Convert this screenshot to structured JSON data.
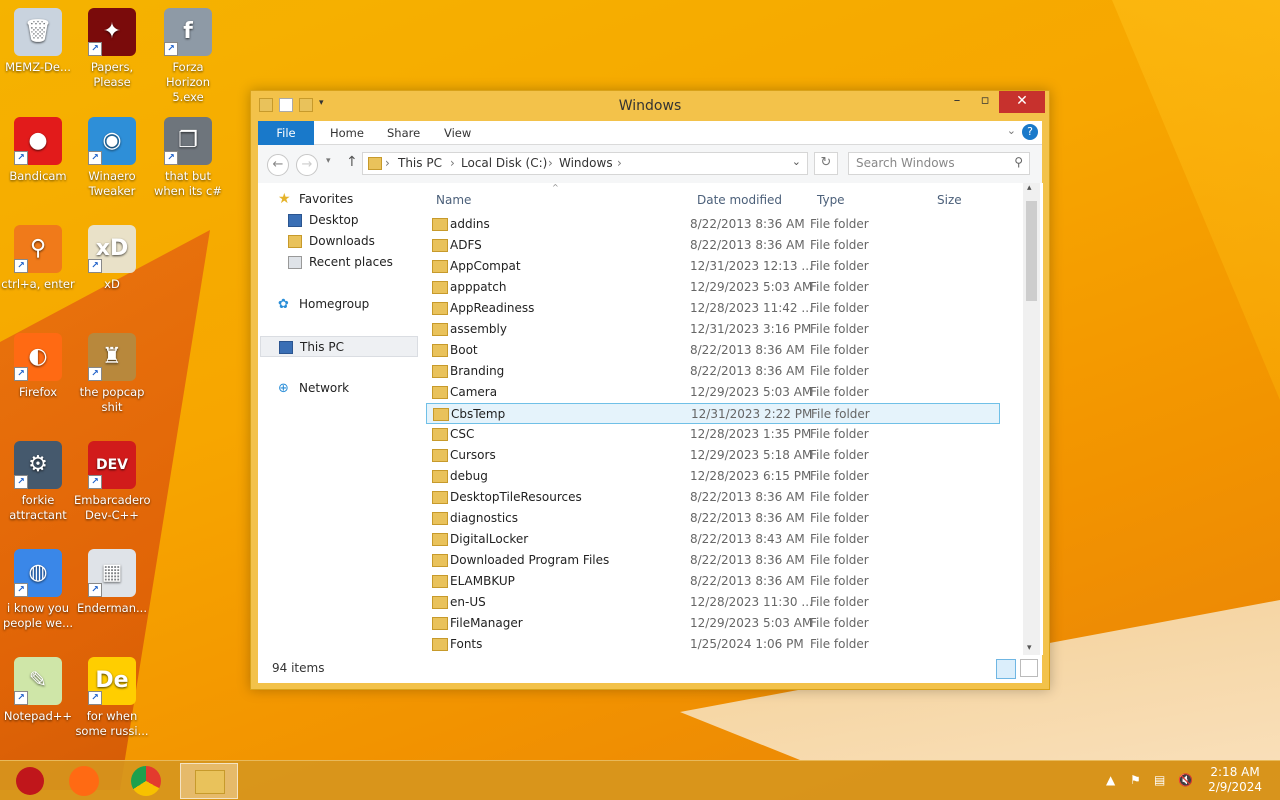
{
  "desktop": {
    "icons": [
      {
        "label": "MEMZ-De...",
        "color": "#c9d3de",
        "glyph": "🗑"
      },
      {
        "label": "Papers, Please",
        "color": "#7a0b0b",
        "glyph": "✦"
      },
      {
        "label": "Forza Horizon 5.exe",
        "color": "#8e9aa6",
        "glyph": "f"
      },
      {
        "label": "Bandicam",
        "color": "#e21b1b",
        "glyph": "●"
      },
      {
        "label": "Winaero Tweaker",
        "color": "#2e8fd8",
        "glyph": "◉"
      },
      {
        "label": "that but when its c#",
        "color": "#6e757c",
        "glyph": "❐"
      },
      {
        "label": "ctrl+a, enter",
        "color": "#f07a1a",
        "glyph": "⚲"
      },
      {
        "label": "xD",
        "color": "#e9e1c8",
        "glyph": "xD"
      },
      {
        "label": "Firefox",
        "color": "#ff6a13",
        "glyph": "◐"
      },
      {
        "label": "the popcap shit",
        "color": "#b8883c",
        "glyph": "♜"
      },
      {
        "label": "forkie attractant",
        "color": "#45596d",
        "glyph": "⚙"
      },
      {
        "label": "Embarcadero Dev-C++",
        "color": "#d11b1b",
        "glyph": "DEV"
      },
      {
        "label": "i know you people we...",
        "color": "#3a87e8",
        "glyph": "◍"
      },
      {
        "label": "Enderman...",
        "color": "#dfe3e8",
        "glyph": "▦"
      },
      {
        "label": "Notepad++",
        "color": "#cfe6a8",
        "glyph": "✎"
      },
      {
        "label": "for when some russi...",
        "color": "#ffce00",
        "glyph": "De"
      }
    ]
  },
  "window": {
    "title": "Windows",
    "tabs": {
      "file": "File",
      "home": "Home",
      "share": "Share",
      "view": "View"
    },
    "address": {
      "crumb1": "This PC",
      "crumb2": "Local Disk (C:)",
      "crumb3": "Windows"
    },
    "search_placeholder": "Search Windows",
    "nav": {
      "favorites": "Favorites",
      "desktop": "Desktop",
      "downloads": "Downloads",
      "recent": "Recent places",
      "homegroup": "Homegroup",
      "thispc": "This PC",
      "network": "Network"
    },
    "columns": {
      "name": "Name",
      "date": "Date modified",
      "type": "Type",
      "size": "Size"
    },
    "files": [
      {
        "name": "addins",
        "date": "8/22/2013 8:36 AM",
        "type": "File folder"
      },
      {
        "name": "ADFS",
        "date": "8/22/2013 8:36 AM",
        "type": "File folder"
      },
      {
        "name": "AppCompat",
        "date": "12/31/2023 12:13 ...",
        "type": "File folder"
      },
      {
        "name": "apppatch",
        "date": "12/29/2023 5:03 AM",
        "type": "File folder"
      },
      {
        "name": "AppReadiness",
        "date": "12/28/2023 11:42 ...",
        "type": "File folder"
      },
      {
        "name": "assembly",
        "date": "12/31/2023 3:16 PM",
        "type": "File folder"
      },
      {
        "name": "Boot",
        "date": "8/22/2013 8:36 AM",
        "type": "File folder"
      },
      {
        "name": "Branding",
        "date": "8/22/2013 8:36 AM",
        "type": "File folder"
      },
      {
        "name": "Camera",
        "date": "12/29/2023 5:03 AM",
        "type": "File folder"
      },
      {
        "name": "CbsTemp",
        "date": "12/31/2023 2:22 PM",
        "type": "File folder"
      },
      {
        "name": "CSC",
        "date": "12/28/2023 1:35 PM",
        "type": "File folder"
      },
      {
        "name": "Cursors",
        "date": "12/29/2023 5:18 AM",
        "type": "File folder"
      },
      {
        "name": "debug",
        "date": "12/28/2023 6:15 PM",
        "type": "File folder"
      },
      {
        "name": "DesktopTileResources",
        "date": "8/22/2013 8:36 AM",
        "type": "File folder"
      },
      {
        "name": "diagnostics",
        "date": "8/22/2013 8:36 AM",
        "type": "File folder"
      },
      {
        "name": "DigitalLocker",
        "date": "8/22/2013 8:43 AM",
        "type": "File folder"
      },
      {
        "name": "Downloaded Program Files",
        "date": "8/22/2013 8:36 AM",
        "type": "File folder"
      },
      {
        "name": "ELAMBKUP",
        "date": "8/22/2013 8:36 AM",
        "type": "File folder"
      },
      {
        "name": "en-US",
        "date": "12/28/2023 11:30 ...",
        "type": "File folder"
      },
      {
        "name": "FileManager",
        "date": "12/29/2023 5:03 AM",
        "type": "File folder"
      },
      {
        "name": "Fonts",
        "date": "1/25/2024 1:06 PM",
        "type": "File folder"
      }
    ],
    "status": "94 items"
  },
  "taskbar": {
    "time": "2:18 AM",
    "date": "2/9/2024"
  },
  "colors": {
    "accent": "#1979ca",
    "folder": "#e9c25b",
    "selection": "#e5f3fb"
  }
}
